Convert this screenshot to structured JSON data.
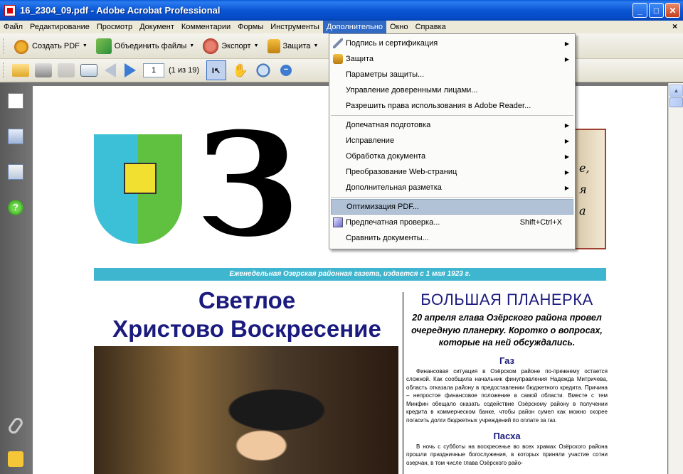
{
  "window": {
    "title": "16_2304_09.pdf - Adobe Acrobat Professional"
  },
  "menubar": {
    "items": [
      "Файл",
      "Редактирование",
      "Просмотр",
      "Документ",
      "Комментарии",
      "Формы",
      "Инструменты",
      "Дополнительно",
      "Окно",
      "Справка"
    ],
    "close_glyph": "×"
  },
  "toolbar1": {
    "create_pdf": "Создать PDF",
    "merge_files": "Объединить файлы",
    "export": "Экспорт",
    "protect": "Защита"
  },
  "toolbar2": {
    "page_number": "1",
    "page_count": "(1 из 19)"
  },
  "dropdown": {
    "items": [
      {
        "label": "Подпись и сертификация",
        "submenu": true,
        "icon": "pen-icon"
      },
      {
        "label": "Защита",
        "submenu": true,
        "icon": "lock-icon"
      },
      {
        "label": "Параметры защиты..."
      },
      {
        "label": "Управление доверенными лицами..."
      },
      {
        "label": "Разрешить права использования в Adobe Reader..."
      },
      {
        "label": "Допечатная подготовка",
        "submenu": true
      },
      {
        "label": "Исправление",
        "submenu": true
      },
      {
        "label": "Обработка документа",
        "submenu": true
      },
      {
        "label": "Преобразование Web-страниц",
        "submenu": true
      },
      {
        "label": "Дополнительная разметка",
        "submenu": true
      },
      {
        "label": "Оптимизация PDF...",
        "selected": true
      },
      {
        "label": "Предпечатная проверка...",
        "shortcut": "Shift+Ctrl+X",
        "icon": "preflight-icon"
      },
      {
        "label": "Сравнить документы..."
      }
    ]
  },
  "document": {
    "masthead_letter": "З",
    "book_text": "е,\nя\nа",
    "banner": "Еженедельная Озерская районная газета, издается с 1 мая 1923 г.",
    "left_headline": "Светлое\nХристово Воскресение",
    "right_headline": "БОЛЬШАЯ ПЛАНЕРКА",
    "right_lead": "20 апреля глава Озёрского района провел очередную планерку. Коротко о вопросах, которые на ней обсуждались.",
    "section1_title": "Газ",
    "section1_text": "Финансовая ситуация в Озёрском районе по-прежнему остается сложной. Как сообщила начальник финуправления Надежда Митричева, область отказала району в предоставлении бюджетного кредита. Причина – непростое финансовое положение в самой области. Вместе с тем Минфин обещало оказать содействие Озёрскому району в получении кредита в коммерческом банке, чтобы район сумел как можно скорее погасить долги бюджетных учреждений по оплате за газ.",
    "section2_title": "Пасха",
    "section2_text": "В ночь с субботы на воскресенье во всех храмах Озёрского района прошли праздничные богослужения, в которых приняли участие сотни озерчан, в том числе глава Озёрского райо-"
  },
  "colors": {
    "title_bar": "#0a56d4",
    "menu_highlight": "#316ac5",
    "banner": "#3fb6cf",
    "headline_blue": "#1b1b7f",
    "selected_item": "#b2c2d6"
  }
}
